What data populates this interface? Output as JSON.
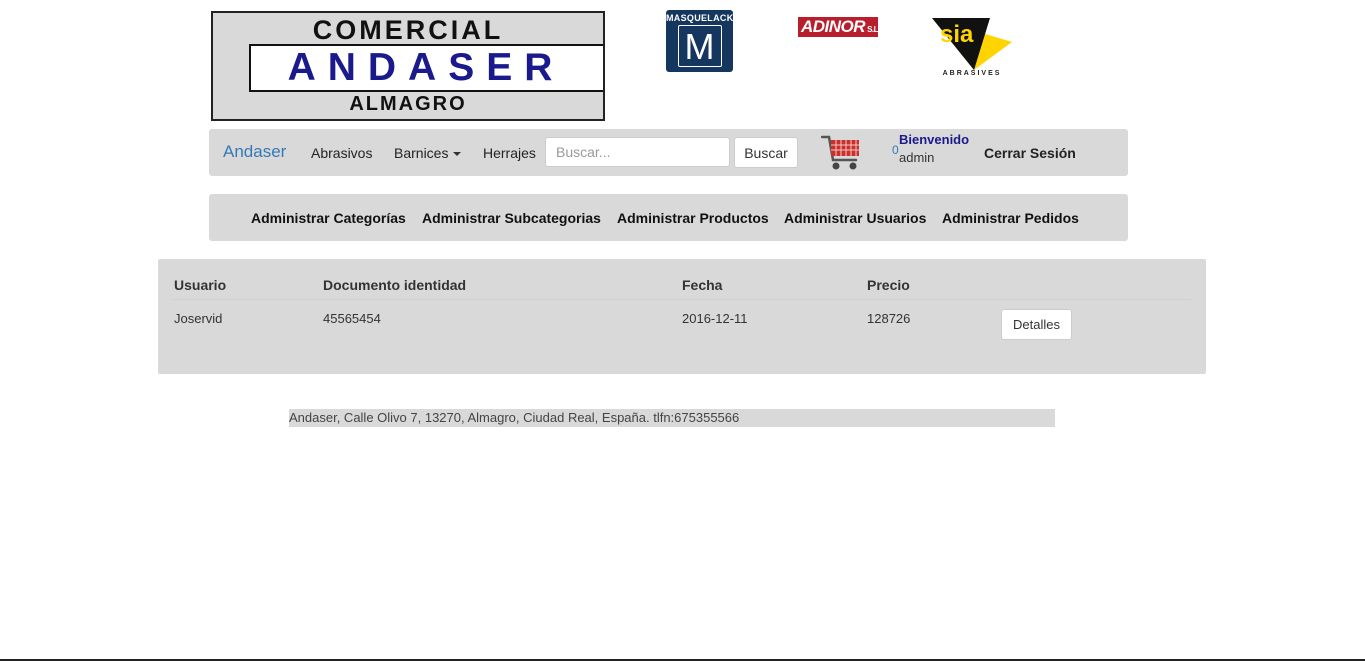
{
  "logos": {
    "main": {
      "line1": "COMERCIAL",
      "line2": "ANDASER",
      "line3": "ALMAGRO"
    },
    "masquelack": {
      "text": "MASQUELACK",
      "letter": "M"
    },
    "adinor": {
      "text": "ADINOR",
      "suffix": "S.L."
    },
    "sia": {
      "text": "sia",
      "sub": "ABRASIVES"
    }
  },
  "navbar": {
    "brand": "Andaser",
    "links": [
      "Abrasivos",
      "Barnices",
      "Herrajes"
    ],
    "search_placeholder": "Buscar...",
    "search_value": "",
    "search_button": "Buscar",
    "cart_icon": "shopping-cart-icon",
    "cart_count": "0",
    "welcome": "Bienvenido",
    "username": "admin",
    "logout": "Cerrar Sesión"
  },
  "admin_menu": [
    "Administrar Categorías",
    "Administrar Subcategorias",
    "Administrar Productos",
    "Administrar Usuarios",
    "Administrar Pedidos"
  ],
  "orders": {
    "columns": [
      "Usuario",
      "Documento identidad",
      "Fecha",
      "Precio"
    ],
    "rows": [
      {
        "usuario": "Joservid",
        "documento": "45565454",
        "fecha": "2016-12-11",
        "precio": "128726",
        "action": "Detalles"
      }
    ]
  },
  "footer": "Andaser, Calle Olivo 7, 13270, Almagro, Ciudad Real, España. tlfn:675355566",
  "colors": {
    "bar_bg": "#d9d9d9",
    "brand": "#337ab7",
    "welcome": "#1a1a8c",
    "masquelack": "#14365f",
    "adinor": "#b81e2c",
    "sia_yellow": "#ffd400",
    "cart_red": "#c9302c"
  }
}
